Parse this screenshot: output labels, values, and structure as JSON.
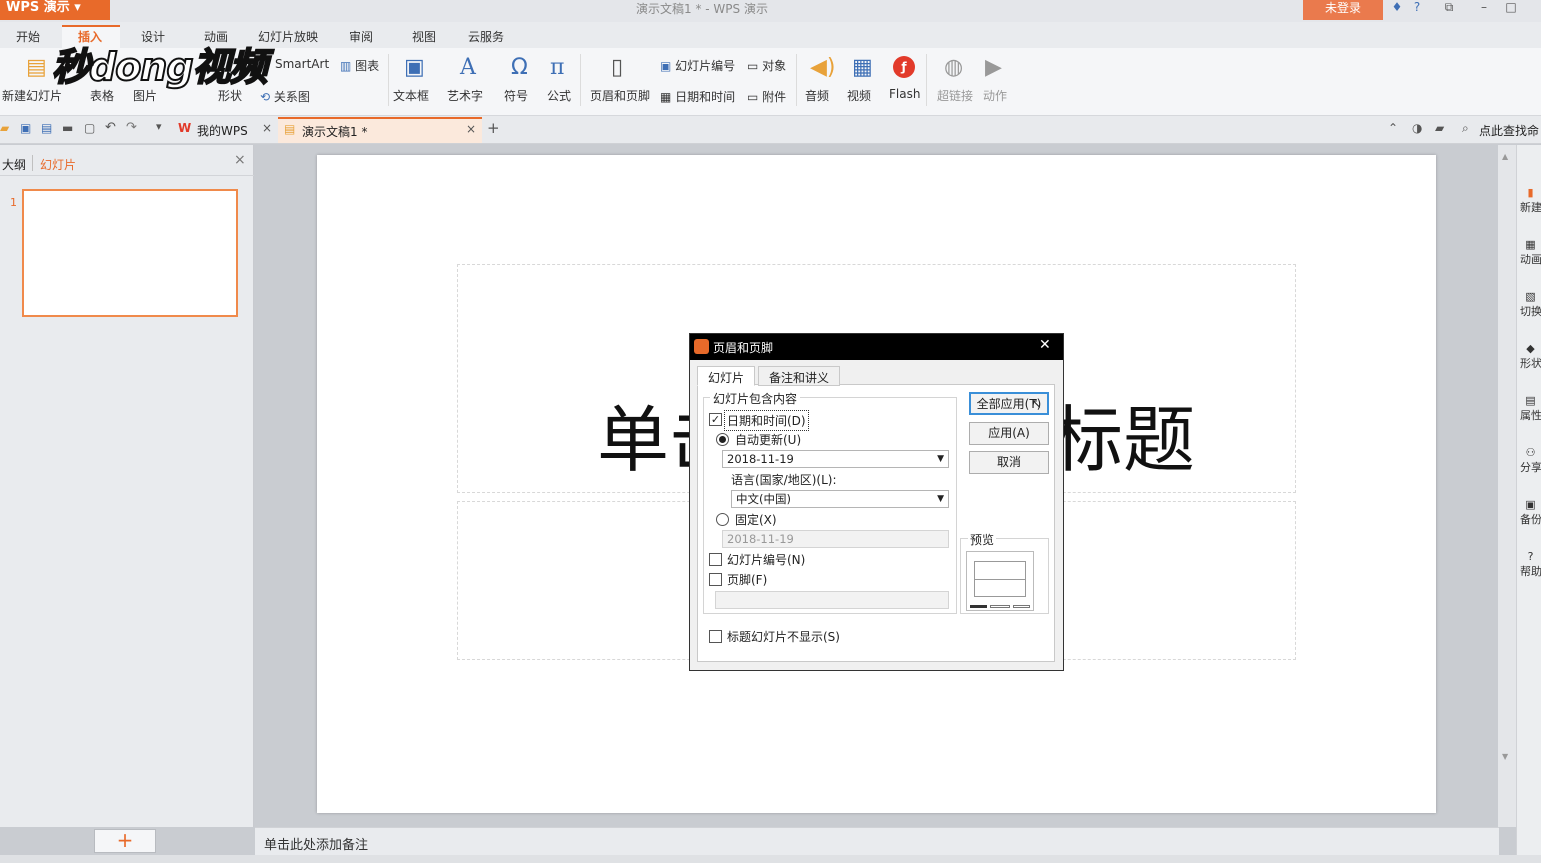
{
  "app": {
    "name": "WPS 演示",
    "doc_title": "演示文稿1 * - WPS 演示",
    "login": "未登录"
  },
  "watermark": {
    "text": "秒dong视频"
  },
  "menu": {
    "tabs": [
      "开始",
      "插入",
      "设计",
      "动画",
      "幻灯片放映",
      "审阅",
      "视图",
      "云服务"
    ],
    "active": "插入"
  },
  "ribbon": {
    "new_slide": "新建幻灯片",
    "table": "表格",
    "picture": "图片",
    "shape": "形状",
    "smartart": "SmartArt",
    "chart": "图表",
    "relation": "关系图",
    "textbox": "文本框",
    "wordart": "艺术字",
    "symbol": "符号",
    "formula": "公式",
    "header_footer": "页眉和页脚",
    "slide_number": "幻灯片编号",
    "object": "对象",
    "date_time": "日期和时间",
    "attachment": "附件",
    "audio": "音频",
    "video": "视频",
    "flash": "Flash",
    "hyperlink": "超链接",
    "action": "动作"
  },
  "doc_tabs": {
    "mywps": "我的WPS",
    "doc": "演示文稿1 *",
    "close": "×",
    "add": "+"
  },
  "search": {
    "placeholder": "点此查找命"
  },
  "panel": {
    "outline": "大纲",
    "slides": "幻灯片",
    "close": "×",
    "slide_num": "1",
    "add": "+"
  },
  "slide": {
    "title_visible": "单击此处添加标题",
    "title_left": "单击",
    "title_right": "标题"
  },
  "notes": {
    "placeholder": "单击此处添加备注"
  },
  "rightbar": [
    "新建",
    "动画",
    "切换",
    "形状",
    "属性",
    "分享",
    "备份",
    "帮助"
  ],
  "dialog": {
    "title": "页眉和页脚",
    "close": "✕",
    "tabs": [
      "幻灯片",
      "备注和讲义"
    ],
    "group": "幻灯片包含内容",
    "date_time": {
      "label": "日期和时间(D)",
      "checked": true
    },
    "auto_update": {
      "label": "自动更新(U)",
      "selected": true,
      "value": "2018-11-19"
    },
    "language": {
      "label": "语言(国家/地区)(L):",
      "value": "中文(中国)"
    },
    "fixed": {
      "label": "固定(X)",
      "value": "2018-11-19"
    },
    "slide_number": {
      "label": "幻灯片编号(N)",
      "checked": false
    },
    "footer": {
      "label": "页脚(F)",
      "checked": false,
      "value": ""
    },
    "hide_on_title": {
      "label": "标题幻灯片不显示(S)",
      "checked": false
    },
    "buttons": {
      "apply_all": "全部应用(T)",
      "apply": "应用(A)",
      "cancel": "取消"
    },
    "preview": "预览"
  },
  "colors": {
    "accent": "#e86a2a",
    "dialog_title": "#000000",
    "thumb_border": "#f08a4b"
  }
}
